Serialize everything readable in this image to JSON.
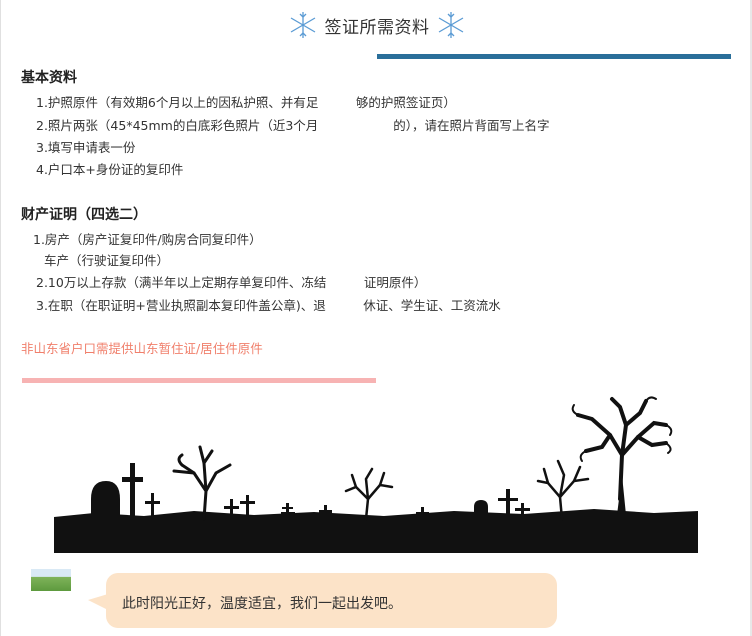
{
  "header": {
    "title": "签证所需资料"
  },
  "basic": {
    "heading": "基本资料",
    "items": [
      "1.护照原件（有效期6个月以上的因私护照、并有足　　　够的护照签证页）",
      "2.照片两张（45*45mm的白底彩色照片（近3个月　　　　　　的），请在照片背面写上名字",
      "3.填写申请表一份",
      "4.户口本+身份证的复印件"
    ]
  },
  "assets": {
    "heading": "财产证明（四选二）",
    "items": [
      "1.房产（房产证复印件/购房合同复印件）",
      "车产（行驶证复印件）",
      "2.10万以上存款（满半年以上定期存单复印件、冻结　　　证明原件）",
      "3.在职（在职证明+营业执照副本复印件盖公章)、退　　　休证、学生证、工资流水"
    ]
  },
  "note": "非山东省户口需提供山东暂住证/居住件原件",
  "chat": {
    "message": "此时阳光正好，温度适宜，我们一起出发吧。"
  },
  "colors": {
    "accent_blue": "#2a6f9a",
    "accent_pink": "#f7b3b3",
    "note_red": "#f07f6b",
    "bubble": "#fce3c8"
  }
}
